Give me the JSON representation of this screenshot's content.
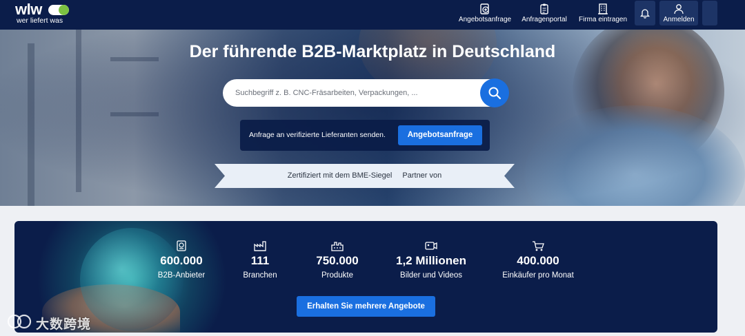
{
  "header": {
    "logo_word": "wlw",
    "logo_tagline": "wer liefert was",
    "nav": [
      {
        "label": "Angebotsanfrage",
        "icon": "request-plus-icon"
      },
      {
        "label": "Anfragenportal",
        "icon": "clipboard-icon"
      },
      {
        "label": "Firma eintragen",
        "icon": "building-icon"
      },
      {
        "label": "",
        "icon": "bell-icon"
      },
      {
        "label": "Anmelden",
        "icon": "user-icon"
      }
    ]
  },
  "hero": {
    "title": "Der führende B2B-Marktplatz in Deutschland",
    "search": {
      "placeholder": "Suchbegriff z. B. CNC-Fräsarbeiten, Verpackungen, ...",
      "value": ""
    },
    "request": {
      "text": "Anfrage an verifizierte Lieferanten senden.",
      "button": "Angebotsanfrage"
    },
    "ribbon": {
      "certified": "Zertifiziert mit dem BME-Siegel",
      "partner": "Partner von"
    }
  },
  "stats": {
    "items": [
      {
        "value": "600.000",
        "label": "B2B-Anbieter",
        "icon": "badge-icon"
      },
      {
        "value": "111",
        "label": "Branchen",
        "icon": "industry-icon"
      },
      {
        "value": "750.000",
        "label": "Produkte",
        "icon": "factory-icon"
      },
      {
        "value": "1,2 Millionen",
        "label": "Bilder und Videos",
        "icon": "media-icon"
      },
      {
        "value": "400.000",
        "label": "Einkäufer pro Monat",
        "icon": "cart-icon"
      }
    ],
    "cta": "Erhalten Sie mehrere Angebote"
  },
  "watermark": {
    "text": "大数跨境"
  },
  "colors": {
    "navy": "#0b1d4a",
    "accent": "#1a6fe0",
    "logo_green": "#7cc242"
  }
}
